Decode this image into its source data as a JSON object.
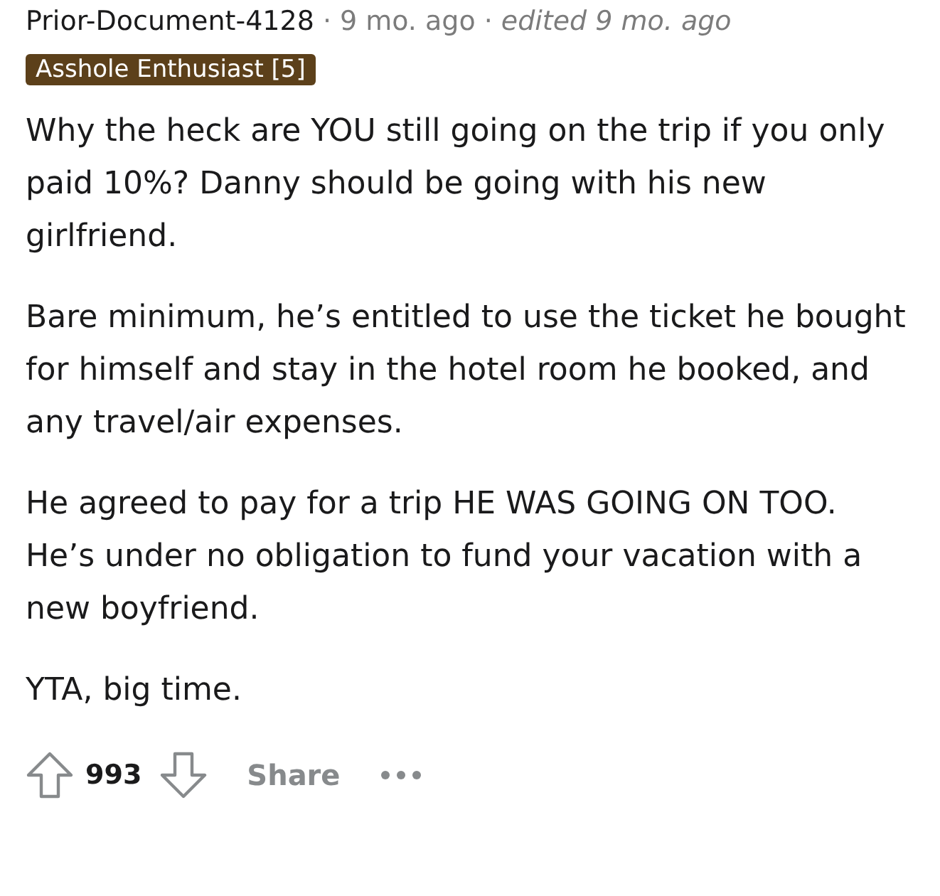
{
  "comment": {
    "author": "Prior-Document-4128",
    "separator_1": "·",
    "time": "9 mo. ago",
    "separator_2": "·",
    "edited": "edited 9 mo. ago",
    "flair": "Asshole Enthusiast [5]",
    "paragraphs": [
      "Why the heck are YOU still going on the trip if you only paid 10%? Danny should be going with his new girlfriend.",
      "Bare minimum, he’s entitled to use the ticket he bought for himself and stay in the hotel room he booked, and any travel/air expenses.",
      "He agreed to pay for a trip HE WAS GOING ON TOO. He’s under no obligation to fund your vacation with a new boyfriend.",
      "YTA, big time."
    ],
    "score": "993",
    "share": "Share"
  }
}
